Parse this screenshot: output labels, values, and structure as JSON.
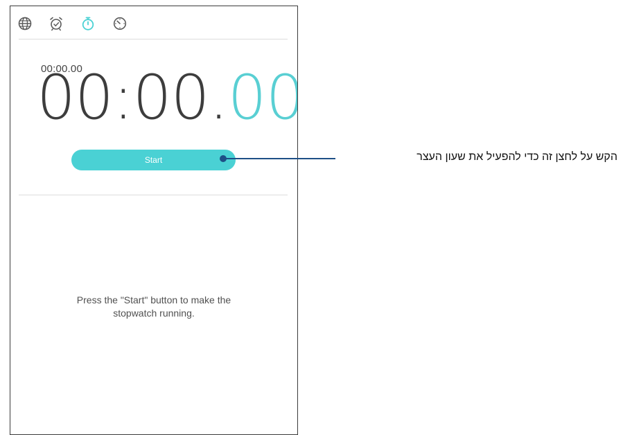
{
  "tabs": [
    {
      "name": "world-clock",
      "icon": "globe-icon",
      "color": "#5a5a5a"
    },
    {
      "name": "alarm",
      "icon": "alarm-clock-icon",
      "color": "#5a5a5a"
    },
    {
      "name": "stopwatch",
      "icon": "stopwatch-icon",
      "color": "#4ad1d4",
      "selected": true
    },
    {
      "name": "timer",
      "icon": "timer-icon",
      "color": "#5a5a5a"
    }
  ],
  "stopwatch": {
    "lap_time": "00:00.00",
    "main_time": "00:00.",
    "main_hundredths": "00",
    "start_label": "Start",
    "hint_line1": "Press the \"Start\" button to make the",
    "hint_line2": "stopwatch running."
  },
  "callout": {
    "text": "הקש על לחצן זה כדי להפעיל את שעון העצר"
  },
  "colors": {
    "accent": "#4ad1d4",
    "callout_line": "#1d4f86",
    "text_dark": "#3d3d3d"
  }
}
